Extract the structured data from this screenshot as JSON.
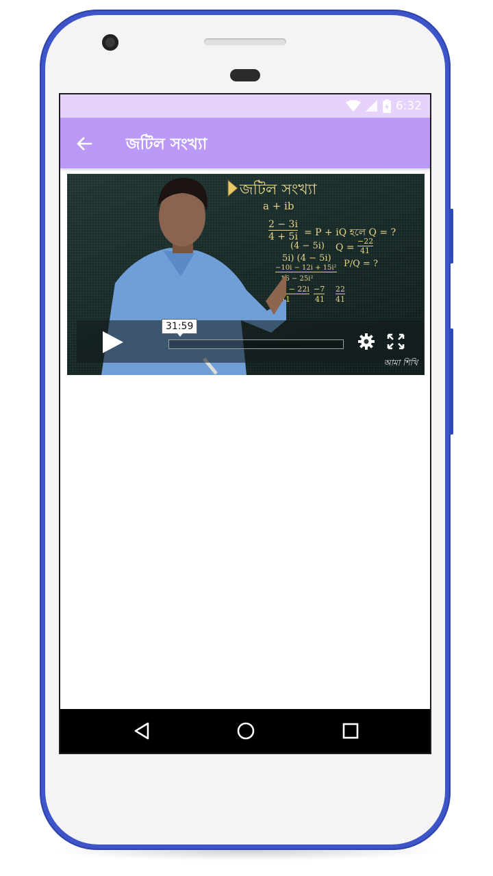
{
  "status_bar": {
    "time": "6:32",
    "icons": [
      "wifi-icon",
      "signal-icon",
      "battery-icon"
    ]
  },
  "app_bar": {
    "title": "জটিল সংখ্যা",
    "back_icon": "arrow-back-icon"
  },
  "video": {
    "board_title": "জটিল সংখ্যা",
    "board_lines": {
      "l1": "a + ib",
      "l2_num": "2 − 3i",
      "l2_den": "4 + 5i",
      "l2_rest": "=  P + iQ হলে Q = ?",
      "l3_left": "(4 − 5i)",
      "l3_right": "Q =",
      "l3_frac_num": "−22",
      "l3_frac_den": "41",
      "l4_left": "5i) (4 − 5i)",
      "l4_right": "P/Q = ?",
      "l5_num": "−10i − 12i + 15i²",
      "l5_den": "16 − 25i²",
      "l6_a_num": "−7 − 22i",
      "l6_a_den": "41",
      "l6_b_num": "−7",
      "l6_b_den": "41",
      "l6_c_num": "22",
      "l6_c_den": "41"
    },
    "time_tooltip": "31:59",
    "watermark": "আমা শিখি",
    "controls": {
      "play_icon": "play-icon",
      "settings_icon": "gear-icon",
      "fullscreen_icon": "fullscreen-icon"
    }
  },
  "nav_bar": {
    "back": "nav-back-icon",
    "home": "nav-home-icon",
    "recents": "nav-recents-icon"
  },
  "colors": {
    "frame": "#3d55c8",
    "status_bar": "#e6d3fb",
    "app_bar": "#bb99f7",
    "chalk": "#e9d58a"
  }
}
